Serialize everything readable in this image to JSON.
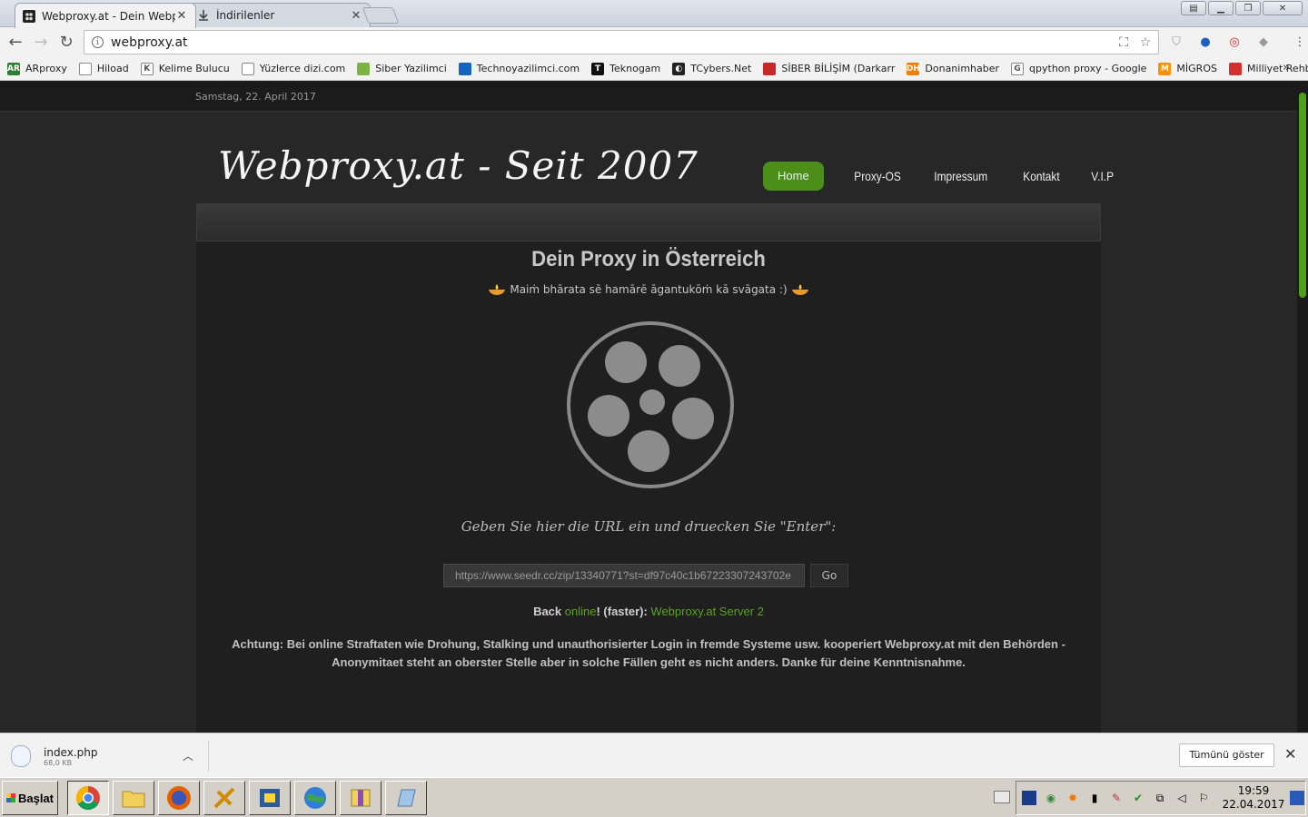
{
  "browser": {
    "tabs": [
      {
        "title": "Webproxy.at - Dein Webpr",
        "active": true
      },
      {
        "title": "İndirilenler",
        "active": false
      }
    ],
    "url": "webproxy.at",
    "window_buttons": {
      "user": "dot"
    }
  },
  "bookmarks": [
    {
      "label": "ARproxy",
      "icon": "ar-icon",
      "color": "#2e7d32"
    },
    {
      "label": "Hiload",
      "icon": "page-icon",
      "color": "#ffffff"
    },
    {
      "label": "Kelime Bulucu",
      "icon": "k-icon",
      "color": "#ffffff"
    },
    {
      "label": "Yüzlerce dizi.com",
      "icon": "page-icon",
      "color": "#ffffff"
    },
    {
      "label": "Siber Yazilimci",
      "icon": "leaf-icon",
      "color": "#7cb342"
    },
    {
      "label": "Technoyazilimci.com",
      "icon": "tech-icon",
      "color": "#1565c0"
    },
    {
      "label": "Teknogam",
      "icon": "t-icon",
      "color": "#111111"
    },
    {
      "label": "TCybers.Net",
      "icon": "tc-icon",
      "color": "#222222"
    },
    {
      "label": "SİBER BİLİŞİM (Darkarr",
      "icon": "siber-icon",
      "color": "#c62828"
    },
    {
      "label": "Donanimhaber",
      "icon": "dh-icon",
      "color": "#f57c00"
    },
    {
      "label": "qpython proxy - Google",
      "icon": "google-icon",
      "color": "#ffffff"
    },
    {
      "label": "MİGROS",
      "icon": "migros-icon",
      "color": "#ff8f00"
    },
    {
      "label": "Milliyet Rehber",
      "icon": "milliyet-icon",
      "color": "#d32f2f"
    }
  ],
  "page": {
    "date": "Samstag, 22. April 2017",
    "logo": "Webproxy.at - Seit 2007",
    "nav": [
      "Home",
      "Proxy-OS",
      "Impressum",
      "Kontakt",
      "V.I.P"
    ],
    "headline": "Dein Proxy in Österreich",
    "welcome": "Maiṁ bhārata sē hamārē āgantukōṁ kā svāgata :)",
    "hint": "Geben Sie hier die URL ein und druecken Sie \"Enter\":",
    "input_value": "https://www.seedr.cc/zip/13340771?st=df97c40c1b67223307243702e",
    "go_label": "Go",
    "back_prefix": "Back ",
    "back_online": "online",
    "back_suffix": "! (faster): ",
    "back_link": "Webproxy.at Server 2",
    "notice": "Achtung: Bei online Straftaten wie Drohung, Stalking und unauthorisierter Login in fremde Systeme usw. kooperiert Webproxy.at mit den Behörden - Anonymitaet steht an oberster Stelle aber in solche Fällen geht es nicht anders. Danke für deine Kenntnisnahme.",
    "colors": {
      "accent": "#4b8e1a",
      "link_green": "#5aa31e"
    }
  },
  "downloads": {
    "file_name": "index.php",
    "file_size": "68,0 KB",
    "show_all": "Tümünü göster"
  },
  "taskbar": {
    "start_label": "Başlat",
    "apps": [
      "chrome-icon",
      "folder-icon",
      "firefox-icon",
      "tool-icon",
      "python-icon",
      "globe-icon",
      "winrar-icon",
      "notepad-icon"
    ],
    "time": "19:59",
    "date": "22.04.2017"
  }
}
